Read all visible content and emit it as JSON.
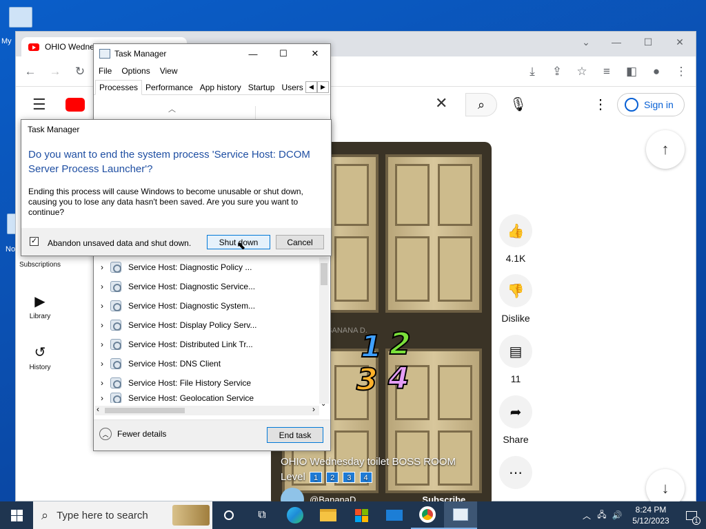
{
  "desktop": {
    "icon_this_pc_label": "My",
    "icon_second_label": "No"
  },
  "chrome": {
    "tab_title": "OHIO Wedne",
    "colors": {
      "youtube_red": "#ff0000",
      "link_blue": "#065fd4"
    }
  },
  "youtube": {
    "sign_in_label": "Sign in",
    "sidebar": [
      {
        "label": "Subscriptions",
        "icon": "subscriptions-icon"
      },
      {
        "label": "Library",
        "icon": "library-icon"
      },
      {
        "label": "History",
        "icon": "history-icon"
      }
    ],
    "video": {
      "title_line1": "OHIO Wednesday toilet BOSS ROOM",
      "title_line2": "Level",
      "chips": [
        "1",
        "2",
        "3",
        "4"
      ],
      "numbers": [
        "1",
        "2",
        "3",
        "4"
      ],
      "watermark": "@BANANA D.",
      "channel": "@BananaD",
      "subscribe": "Subscribe"
    },
    "actions": {
      "like_count": "4.1K",
      "dislike_label": "Dislike",
      "comment_count": "11",
      "share_label": "Share"
    }
  },
  "task_manager": {
    "title": "Task Manager",
    "menu": [
      "File",
      "Options",
      "View"
    ],
    "tabs": [
      "Processes",
      "Performance",
      "App history",
      "Startup",
      "Users"
    ],
    "processes": [
      "Service Host: Diagnostic Policy ...",
      "Service Host: Diagnostic Service...",
      "Service Host: Diagnostic System...",
      "Service Host: Display Policy Serv...",
      "Service Host: Distributed Link Tr...",
      "Service Host: DNS Client",
      "Service Host: File History Service",
      "Service Host: Geolocation Service"
    ],
    "fewer_details": "Fewer details",
    "end_task": "End task"
  },
  "dialog": {
    "title": "Task Manager",
    "question": "Do you want to end the system process 'Service Host: DCOM Server Process Launcher'?",
    "message": "Ending this process will cause Windows to become unusable or shut down, causing you to lose any data hasn't been saved. Are you sure you want to continue?",
    "checkbox_label": "Abandon unsaved data and shut down.",
    "checkbox_checked": true,
    "shutdown_button": "Shut down",
    "cancel_button": "Cancel"
  },
  "taskbar": {
    "search_placeholder": "Type here to search",
    "time": "8:24 PM",
    "date": "5/12/2023",
    "notification_count": "1"
  }
}
